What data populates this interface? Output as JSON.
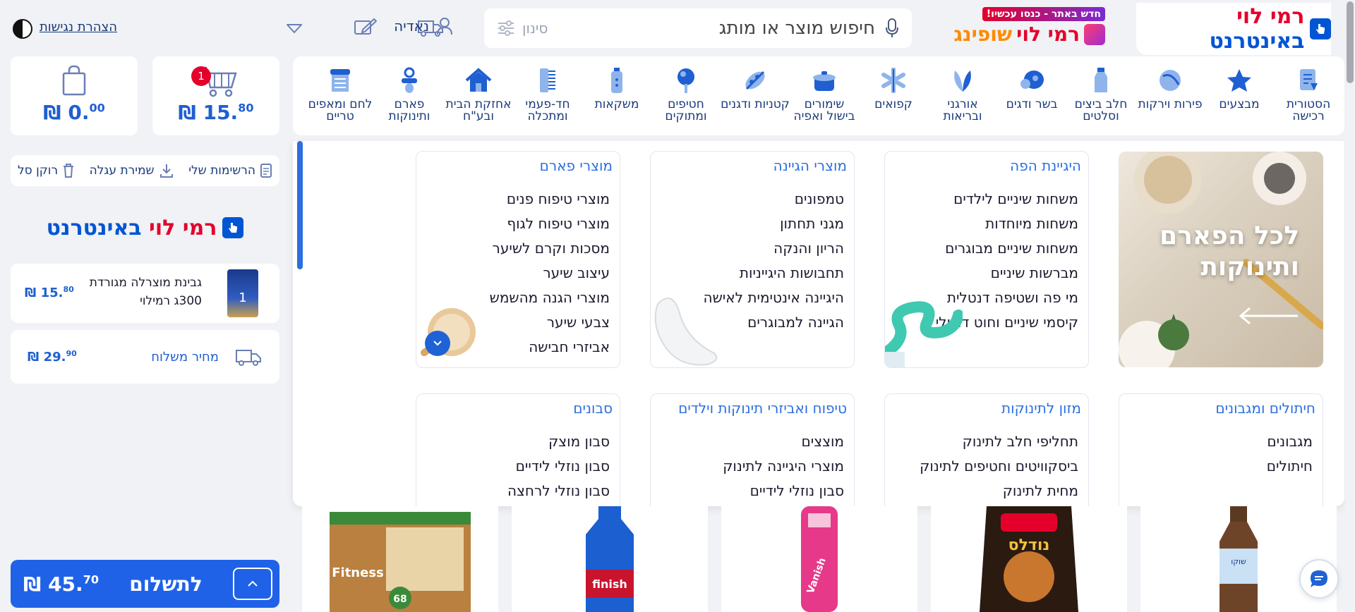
{
  "header": {
    "logo": {
      "part1": "רמי לוי",
      "part2": "באינטרנט"
    },
    "shopping": {
      "badge": "חדש באתר - כנסו עכשיו!",
      "name1": "רמי לוי",
      "name2": "שופינג"
    },
    "search": {
      "placeholder": "חיפוש מוצר או מותג",
      "filter_label": "סינון"
    },
    "user_name": "נאדיה",
    "accessibility": "הצהרת נגישות"
  },
  "categories": [
    {
      "label": "הסטורית רכישה",
      "icon": "receipt-icon"
    },
    {
      "label": "מבצעים",
      "icon": "star-icon"
    },
    {
      "label": "פירות וירקות",
      "icon": "fruit-icon"
    },
    {
      "label": "חלב ביצים וסלטים",
      "icon": "milk-icon"
    },
    {
      "label": "בשר ודגים",
      "icon": "meat-icon"
    },
    {
      "label": "אורגני ובריאות",
      "icon": "leaf-icon"
    },
    {
      "label": "קפואים",
      "icon": "snowflake-icon"
    },
    {
      "label": "שימורים בישול ואפיה",
      "icon": "pot-icon"
    },
    {
      "label": "קטניות ודגנים",
      "icon": "grain-icon"
    },
    {
      "label": "חטיפים ומתוקים",
      "icon": "lollipop-icon"
    },
    {
      "label": "משקאות",
      "icon": "bottle-icon"
    },
    {
      "label": "חד-פעמי ומתכלה",
      "icon": "disposable-icon"
    },
    {
      "label": "אחזקת הבית ובע\"ח",
      "icon": "home-icon"
    },
    {
      "label": "פארם ותינוקות",
      "icon": "pacifier-icon"
    },
    {
      "label": "לחם ומאפים טריים",
      "icon": "bread-icon"
    }
  ],
  "mega_menu": {
    "promo": {
      "line1": "לכל הפארם",
      "line2": "ותינוקות"
    },
    "row1": [
      {
        "title": "היגיינת הפה",
        "items": [
          "משחות שיניים לילדים",
          "משחות מיוחדות",
          "משחות שיניים מבוגרים",
          "מברשות שיניים",
          "מי פה ושטיפה דנטלית",
          "קיסמי שיניים וחוט דנטלי"
        ]
      },
      {
        "title": "מוצרי הגיינה",
        "items": [
          "טמפונים",
          "מגני תחתון",
          "הריון והנקה",
          "תחבושות היגייניות",
          "היגיינה אינטימית לאישה",
          "הגיינה למבוגרים"
        ]
      },
      {
        "title": "מוצרי פארם",
        "items": [
          "מוצרי טיפוח פנים",
          "מוצרי טיפוח לגוף",
          "מסכות וקרם לשיער",
          "עיצוב שיער",
          "מוצרי הגנה מהשמש",
          "צבעי שיער",
          "אביזרי חבישה"
        ]
      }
    ],
    "row2": [
      {
        "title": "חיתולים ומגבונים",
        "items": [
          "מגבונים",
          "חיתולים"
        ]
      },
      {
        "title": "מזון לתינוקות",
        "items": [
          "תחליפי חלב לתינוק",
          "ביסקוויטים וחטיפים לתינוק",
          "מחית לתינוק"
        ]
      },
      {
        "title": "טיפוח ואביזרי תינוקות וילדים",
        "items": [
          "מוצצים",
          "מוצרי היגיינה לתינוק",
          "סבון נוזלי לידיים"
        ]
      },
      {
        "title": "סבונים",
        "items": [
          "סבון מוצק",
          "סבון נוזלי לידיים",
          "סבון נוזלי לרחצה"
        ]
      }
    ]
  },
  "cart": {
    "count": "1",
    "total_main": "15.",
    "total_cents": "80",
    "currency": "₪",
    "bag_main": "0.",
    "bag_cents": "00"
  },
  "actions": {
    "lists": "הרשימות שלי",
    "save": "שמירת עגלה",
    "empty": "רוקן סל"
  },
  "side_logo": {
    "part1": "רמי לוי",
    "part2": "באינטרנט"
  },
  "cart_item": {
    "name": "גבינת מוצרלה מגורדת 300ג רמילוי",
    "price_main": "15.",
    "price_cents": "80",
    "thumb_label": "1"
  },
  "shipping": {
    "label": "מחיר משלוח",
    "price_main": "29.",
    "price_cents": "90"
  },
  "checkout": {
    "label": "לתשלום",
    "total_main": "45.",
    "total_cents": "70"
  },
  "products": [
    {
      "name": "Fitness",
      "color": "#8a5a2b",
      "badge": "68"
    },
    {
      "name": "finish",
      "color": "#1b5fd1"
    },
    {
      "name": "Vanish",
      "color": "#e6398a"
    },
    {
      "name": "נודלס",
      "color": "#2b1a10"
    },
    {
      "name": "שוקו",
      "color": "#5c3a22"
    }
  ],
  "colors": {
    "brand_blue": "#0055d4",
    "brand_red": "#e4002b",
    "accent": "#2b6fe0",
    "checkout": "#1f62e8"
  }
}
